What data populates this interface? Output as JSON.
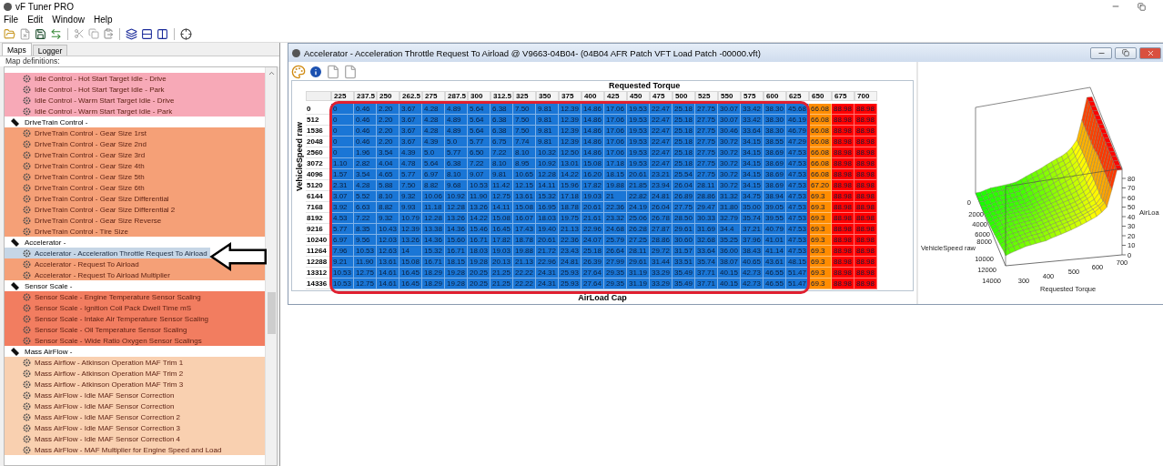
{
  "app": {
    "title": "vF Tuner PRO"
  },
  "menu": [
    "File",
    "Edit",
    "Window",
    "Help"
  ],
  "sidebar": {
    "tabs": [
      {
        "label": "Maps",
        "selected": true
      },
      {
        "label": "Logger",
        "selected": false
      }
    ],
    "heading": "Map definitions:",
    "groups": [
      {
        "color": "#f7a9b7",
        "children": [
          {
            "label": "Idle Control - Hot Start Target Idle - Drive",
            "selected": false
          },
          {
            "label": "Idle Control - Hot Start Target Idle - Park",
            "selected": false
          },
          {
            "label": "Idle Control - Warm Start Target Idle - Drive",
            "selected": false
          },
          {
            "label": "Idle Control - Warm Start Target Idle - Park",
            "selected": false
          }
        ]
      },
      {
        "label": "DriveTrain Control -",
        "color": "#f5a077",
        "children": [
          {
            "label": "DriveTrain Control - Gear Size 1rst",
            "selected": false
          },
          {
            "label": "DriveTrain Control - Gear Size 2nd",
            "selected": false
          },
          {
            "label": "DriveTrain Control - Gear Size 3rd",
            "selected": false
          },
          {
            "label": "DriveTrain Control - Gear Size 4th",
            "selected": false
          },
          {
            "label": "DriveTrain Control - Gear Size 5th",
            "selected": false
          },
          {
            "label": "DriveTrain Control - Gear Size 6th",
            "selected": false
          },
          {
            "label": "DriveTrain Control - Gear Size Differential",
            "selected": false
          },
          {
            "label": "DriveTrain Control - Gear Size Differential 2",
            "selected": false
          },
          {
            "label": "DriveTrain Control - Gear Size Reverse",
            "selected": false
          },
          {
            "label": "DriveTrain Control - Tire Size",
            "selected": false
          }
        ]
      },
      {
        "label": "Accelerator -",
        "color": "#f5a077",
        "children": [
          {
            "label": "Accelerator - Acceleration Throttle Request To Airload",
            "selected": true
          },
          {
            "label": "Accelerator - Request To Airload",
            "selected": false
          },
          {
            "label": "Accelerator - Request To Airload Multiplier",
            "selected": false
          }
        ]
      },
      {
        "label": "Sensor Scale -",
        "color": "#f27d60",
        "children": [
          {
            "label": "Sensor Scale - Engine Temperature Sensor Scaling",
            "selected": false
          },
          {
            "label": "Sensor Scale - Ignition Coil Pack Dwell Time mS",
            "selected": false
          },
          {
            "label": "Sensor Scale - Intake Air Temperature Sensor Scaling",
            "selected": false
          },
          {
            "label": "Sensor Scale - Oil Temperature Sensor Scaling",
            "selected": false
          },
          {
            "label": "Sensor Scale - Wide Ratio Oxygen Sensor Scalings",
            "selected": false
          }
        ]
      },
      {
        "label": "Mass AirFlow -",
        "color": "#f9d0b0",
        "children": [
          {
            "label": "Mass Airflow - Atkinson Operation MAF Trim 1",
            "selected": false
          },
          {
            "label": "Mass Airflow - Atkinson Operation MAF Trim 2",
            "selected": false
          },
          {
            "label": "Mass Airflow - Atkinson Operation MAF Trim 3",
            "selected": false
          },
          {
            "label": "Mass AirFlow - Idle MAF Sensor Correction",
            "selected": false
          },
          {
            "label": "Mass AirFlow - Idle MAF Sensor Correction",
            "selected": false
          },
          {
            "label": "Mass AirFlow - Idle MAF Sensor Correction 2",
            "selected": false
          },
          {
            "label": "Mass AirFlow - Idle MAF Sensor Correction 3",
            "selected": false
          },
          {
            "label": "Mass AirFlow - Idle MAF Sensor Correction 4",
            "selected": false
          },
          {
            "label": "Mass AirFlow - MAF Multiplier for Engine Speed and Load",
            "selected": false
          }
        ]
      }
    ]
  },
  "map_window": {
    "title": "Accelerator - Acceleration Throttle Request To Airload @ V9663-04B04- (04B04 AFR Patch VFT Load Patch -00000.vft)",
    "table": {
      "x_axis_label": "Requested Torque",
      "y_axis_label": "VehicleSpeed raw",
      "footer_label": "AirLoad Cap",
      "columns": [
        {
          "label": "225",
          "color": "#1a76d6"
        },
        {
          "label": "237.5",
          "color": "#1a76d6"
        },
        {
          "label": "250",
          "color": "#1a76d6"
        },
        {
          "label": "262.5",
          "color": "#1a76d6"
        },
        {
          "label": "275",
          "color": "#1a76d6"
        },
        {
          "label": "287.5",
          "color": "#1a76d6"
        },
        {
          "label": "300",
          "color": "#1a76d6"
        },
        {
          "label": "312.5",
          "color": "#1a76d6"
        },
        {
          "label": "325",
          "color": "#1a76d6"
        },
        {
          "label": "350",
          "color": "#1a76d6"
        },
        {
          "label": "375",
          "color": "#1a76d6"
        },
        {
          "label": "400",
          "color": "#1a76d6"
        },
        {
          "label": "425",
          "color": "#1a76d6"
        },
        {
          "label": "450",
          "color": "#1a76d6"
        },
        {
          "label": "475",
          "color": "#1a76d6"
        },
        {
          "label": "500",
          "color": "#1a76d6"
        },
        {
          "label": "525",
          "color": "#1a76d6"
        },
        {
          "label": "550",
          "color": "#1a76d6"
        },
        {
          "label": "575",
          "color": "#1a76d6"
        },
        {
          "label": "600",
          "color": "#1a76d6"
        },
        {
          "label": "625",
          "color": "#1a76d6"
        },
        {
          "label": "650",
          "color": "#ff8c00"
        },
        {
          "label": "675",
          "color": "#ff0000"
        },
        {
          "label": "700",
          "color": "#ff0000"
        }
      ],
      "rows": [
        {
          "label": "0",
          "cells": [
            "0",
            "0.46",
            "2.20",
            "3.67",
            "4.28",
            "4.89",
            "5.64",
            "6.38",
            "7.50",
            "9.81",
            "12.39",
            "14.86",
            "17.06",
            "19.53",
            "22.47",
            "25.18",
            "27.75",
            "30.07",
            "33.42",
            "38.30",
            "45.68",
            "66.08",
            "88.98",
            "88.98"
          ]
        },
        {
          "label": "512",
          "cells": [
            "0",
            "0.46",
            "2.20",
            "3.67",
            "4.28",
            "4.89",
            "5.64",
            "6.38",
            "7.50",
            "9.81",
            "12.39",
            "14.86",
            "17.06",
            "19.53",
            "22.47",
            "25.18",
            "27.75",
            "30.07",
            "33.42",
            "38.30",
            "46.19",
            "66.08",
            "88.98",
            "88.98"
          ]
        },
        {
          "label": "1536",
          "cells": [
            "0",
            "0.46",
            "2.20",
            "3.67",
            "4.28",
            "4.89",
            "5.64",
            "6.38",
            "7.50",
            "9.81",
            "12.39",
            "14.86",
            "17.06",
            "19.53",
            "22.47",
            "25.18",
            "27.75",
            "30.46",
            "33.64",
            "38.30",
            "46.79",
            "66.08",
            "88.98",
            "88.98"
          ]
        },
        {
          "label": "2048",
          "cells": [
            "0",
            "0.46",
            "2.20",
            "3.67",
            "4.39",
            "5.0",
            "5.77",
            "6.75",
            "7.74",
            "9.81",
            "12.39",
            "14.86",
            "17.06",
            "19.53",
            "22.47",
            "25.18",
            "27.75",
            "30.72",
            "34.15",
            "38.55",
            "47.29",
            "66.08",
            "88.98",
            "88.98"
          ]
        },
        {
          "label": "2560",
          "cells": [
            "0",
            "1.96",
            "3.54",
            "4.39",
            "5.0",
            "5.77",
            "6.50",
            "7.22",
            "8.10",
            "10.32",
            "12.50",
            "14.86",
            "17.06",
            "19.53",
            "22.47",
            "25.18",
            "27.75",
            "30.72",
            "34.15",
            "38.69",
            "47.53",
            "66.08",
            "88.98",
            "88.98"
          ]
        },
        {
          "label": "3072",
          "cells": [
            "1.10",
            "2.82",
            "4.04",
            "4.78",
            "5.64",
            "6.38",
            "7.22",
            "8.10",
            "8.95",
            "10.92",
            "13.01",
            "15.08",
            "17.18",
            "19.53",
            "22.47",
            "25.18",
            "27.75",
            "30.72",
            "34.15",
            "38.69",
            "47.53",
            "66.08",
            "88.98",
            "88.98"
          ]
        },
        {
          "label": "4096",
          "cells": [
            "1.57",
            "3.54",
            "4.65",
            "5.77",
            "6.97",
            "8.10",
            "9.07",
            "9.81",
            "10.65",
            "12.28",
            "14.22",
            "16.20",
            "18.15",
            "20.61",
            "23.21",
            "25.54",
            "27.75",
            "30.72",
            "34.15",
            "38.69",
            "47.53",
            "66.08",
            "88.98",
            "88.98"
          ]
        },
        {
          "label": "5120",
          "cells": [
            "2.31",
            "4.28",
            "5.88",
            "7.50",
            "8.82",
            "9.68",
            "10.53",
            "11.42",
            "12.15",
            "14.11",
            "15.96",
            "17.82",
            "19.88",
            "21.85",
            "23.94",
            "26.04",
            "28.11",
            "30.72",
            "34.15",
            "38.69",
            "47.53",
            "67.20",
            "88.98",
            "88.98"
          ]
        },
        {
          "label": "6144",
          "cells": [
            "3.07",
            "5.52",
            "8.10",
            "9.32",
            "10.06",
            "10.92",
            "11.90",
            "12.75",
            "13.61",
            "15.32",
            "17.18",
            "19.03",
            "21",
            "22.82",
            "24.81",
            "26.89",
            "28.86",
            "31.32",
            "34.75",
            "38.94",
            "47.53",
            "69.3",
            "88.98",
            "88.98"
          ]
        },
        {
          "label": "7168",
          "cells": [
            "3.92",
            "6.63",
            "8.82",
            "9.93",
            "11.18",
            "12.28",
            "13.26",
            "14.11",
            "15.08",
            "16.95",
            "18.78",
            "20.61",
            "22.36",
            "24.19",
            "26.04",
            "27.75",
            "29.47",
            "31.80",
            "35.00",
            "39.05",
            "47.53",
            "69.3",
            "88.98",
            "88.98"
          ]
        },
        {
          "label": "8192",
          "cells": [
            "4.53",
            "7.22",
            "9.32",
            "10.79",
            "12.28",
            "13.26",
            "14.22",
            "15.08",
            "16.07",
            "18.03",
            "19.75",
            "21.61",
            "23.32",
            "25.06",
            "26.78",
            "28.50",
            "30.33",
            "32.79",
            "35.74",
            "39.55",
            "47.53",
            "69.3",
            "88.98",
            "88.98"
          ]
        },
        {
          "label": "9216",
          "cells": [
            "5.77",
            "8.35",
            "10.43",
            "12.39",
            "13.38",
            "14.36",
            "15.46",
            "16.45",
            "17.43",
            "19.40",
            "21.13",
            "22.96",
            "24.68",
            "26.28",
            "27.87",
            "29.61",
            "31.69",
            "34.4",
            "37.21",
            "40.79",
            "47.53",
            "69.3",
            "88.98",
            "88.98"
          ]
        },
        {
          "label": "10240",
          "cells": [
            "6.97",
            "9.56",
            "12.03",
            "13.26",
            "14.36",
            "15.60",
            "16.71",
            "17.82",
            "18.78",
            "20.61",
            "22.36",
            "24.07",
            "25.79",
            "27.25",
            "28.86",
            "30.60",
            "32.68",
            "35.25",
            "37.96",
            "41.01",
            "47.53",
            "69.3",
            "88.98",
            "88.98"
          ]
        },
        {
          "label": "11264",
          "cells": [
            "7.96",
            "10.53",
            "12.63",
            "14",
            "15.32",
            "16.71",
            "18.03",
            "19.03",
            "19.88",
            "21.72",
            "23.43",
            "25.18",
            "26.64",
            "28.11",
            "29.72",
            "31.57",
            "33.64",
            "36.00",
            "38.43",
            "41.14",
            "47.53",
            "69.3",
            "88.98",
            "88.98"
          ]
        },
        {
          "label": "12288",
          "cells": [
            "9.21",
            "11.90",
            "13.61",
            "15.08",
            "16.71",
            "18.15",
            "19.28",
            "20.13",
            "21.13",
            "22.96",
            "24.81",
            "26.39",
            "27.99",
            "29.61",
            "31.44",
            "33.51",
            "35.74",
            "38.07",
            "40.65",
            "43.61",
            "48.15",
            "69.3",
            "88.98",
            "88.98"
          ]
        },
        {
          "label": "13312",
          "cells": [
            "10.53",
            "12.75",
            "14.61",
            "16.45",
            "18.29",
            "19.28",
            "20.25",
            "21.25",
            "22.22",
            "24.31",
            "25.93",
            "27.64",
            "29.35",
            "31.19",
            "33.29",
            "35.49",
            "37.71",
            "40.15",
            "42.73",
            "46.55",
            "51.47",
            "69.3",
            "88.98",
            "88.98"
          ]
        },
        {
          "label": "14336",
          "cells": [
            "10.53",
            "12.75",
            "14.61",
            "16.45",
            "18.29",
            "19.28",
            "20.25",
            "21.25",
            "22.22",
            "24.31",
            "25.93",
            "27.64",
            "29.35",
            "31.19",
            "33.29",
            "35.49",
            "37.71",
            "40.15",
            "42.73",
            "46.55",
            "51.47",
            "69.3",
            "88.98",
            "88.98"
          ]
        }
      ]
    },
    "surface_plot": {
      "y_axis_label": "VehicleSpeed raw",
      "x_axis_label": "Requested Torque",
      "z_axis_label": "AirLoa",
      "y_ticks": [
        "0",
        "2000",
        "4000",
        "6000",
        "8000",
        "10000",
        "12000",
        "14000"
      ],
      "x_ticks": [
        "300",
        "400",
        "500",
        "600",
        "700"
      ],
      "z_ticks": [
        "80",
        "70",
        "60",
        "50",
        "40",
        "30",
        "20",
        "10",
        "0"
      ]
    }
  }
}
